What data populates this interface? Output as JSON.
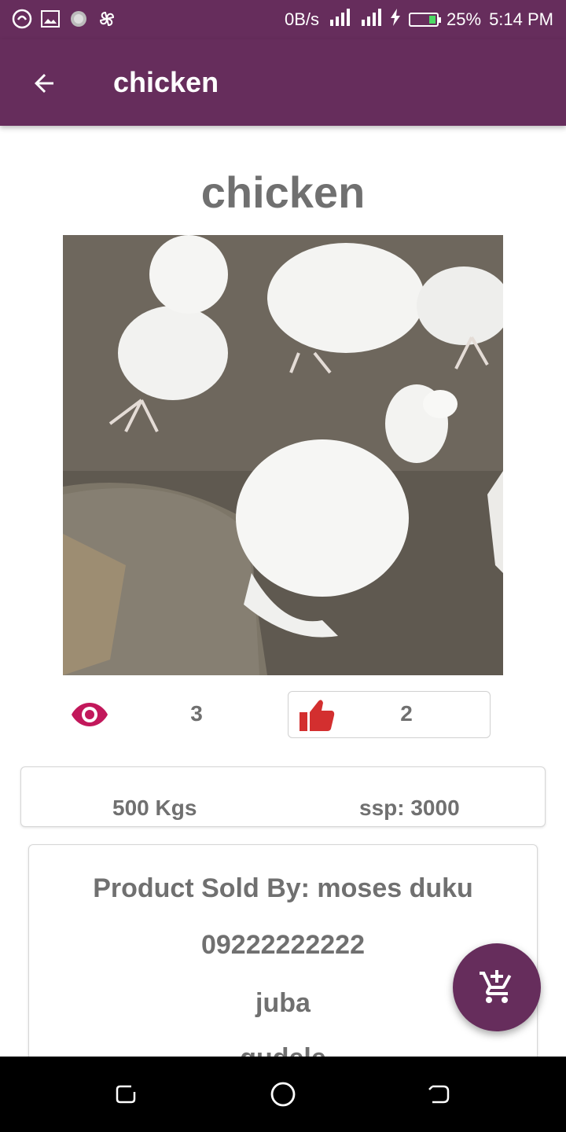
{
  "status_bar": {
    "net_speed": "0B/s",
    "battery_percent": "25%",
    "time": "5:14 PM",
    "battery_level": 0.25
  },
  "app_bar": {
    "title": "chicken",
    "back_icon": "arrow-back-icon"
  },
  "product": {
    "title": "chicken",
    "views": "3",
    "likes": "2",
    "quantity": "500 Kgs",
    "price": "ssp: 3000"
  },
  "seller": {
    "sold_by": "Product Sold  By: moses duku",
    "phone": "09222222222",
    "city": "juba",
    "area": "gudele"
  },
  "colors": {
    "primary": "#662d5c",
    "eye_icon": "#c2185b",
    "like_icon": "#d32f2f",
    "text_gray": "#707070"
  },
  "icons": {
    "views": "eye-icon",
    "likes": "thumbs-up-icon",
    "fab": "add-to-cart-icon"
  }
}
